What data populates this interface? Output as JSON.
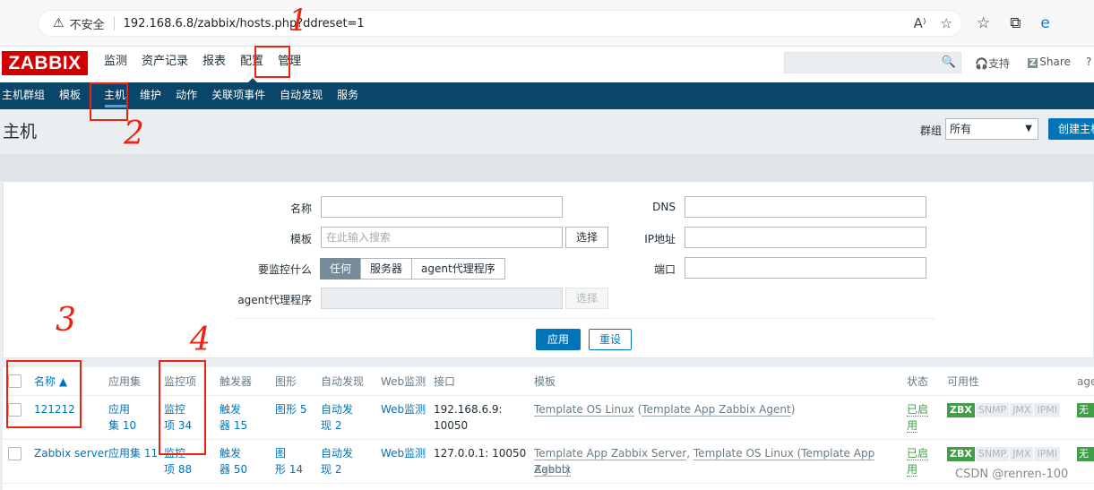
{
  "browser": {
    "security_label": "不安全",
    "url": "192.168.6.8/zabbix/hosts.php?ddreset=1"
  },
  "topnav": {
    "logo": "ZABBIX",
    "items": [
      "监测",
      "资产记录",
      "报表",
      "配置",
      "管理"
    ],
    "support": "支持",
    "share": "Share",
    "help": "?"
  },
  "subnav": {
    "items": [
      "主机群组",
      "模板",
      "主机",
      "维护",
      "动作",
      "关联项事件",
      "自动发现",
      "服务"
    ]
  },
  "header": {
    "title": "主机",
    "group_label": "群组",
    "group_value": "所有",
    "create_button": "创建主机"
  },
  "filter": {
    "name_label": "名称",
    "template_label": "模板",
    "template_placeholder": "在此输入搜索",
    "select_label": "选择",
    "monitored_by_label": "要监控什么",
    "monitored_options": [
      "任何",
      "服务器",
      "agent代理程序"
    ],
    "proxy_label": "agent代理程序",
    "proxy_select_label": "选择",
    "dns_label": "DNS",
    "ip_label": "IP地址",
    "port_label": "端口",
    "apply": "应用",
    "reset": "重设"
  },
  "table": {
    "headers": {
      "name": "名称 ▲",
      "applications": "应用集",
      "items": "监控项",
      "triggers": "触发器",
      "graphs": "图形",
      "discovery": "自动发现",
      "web": "Web监测",
      "interface": "接口",
      "templates": "模板",
      "status": "状态",
      "availability": "可用性",
      "agent_encryption": "age"
    },
    "rows": [
      {
        "name": "121212",
        "app_1": "应用",
        "app_2": "集 10",
        "items_1": "监控",
        "items_2": "项 34",
        "triggers_1": "触发",
        "triggers_2": "器 15",
        "graphs_1": "图形 5",
        "graphs_2": "",
        "discovery_1": "自动发",
        "discovery_2": "现 2",
        "web": "Web监测",
        "interface_1": "192.168.6.9:",
        "interface_2": "10050",
        "tpl_a": "Template OS Linux",
        "tpl_b": " (",
        "tpl_c": "Template App Zabbix Agent",
        "tpl_d": ")",
        "status_1": "已启",
        "status_2": "用",
        "enc": "无"
      },
      {
        "name": "Zabbix server",
        "app_1": "应用集 11",
        "app_2": "",
        "items_1": "监控",
        "items_2": "项 88",
        "triggers_1": "触发",
        "triggers_2": "器 50",
        "graphs_1": "图",
        "graphs_2": "形 14",
        "discovery_1": "自动发",
        "discovery_2": "现 2",
        "web": "Web监测",
        "interface_1": "127.0.0.1: 10050",
        "interface_2": "",
        "tpl_a": "Template App Zabbix Server",
        "tpl_b": ", ",
        "tpl_c": "Template OS Linux",
        "tpl_d": " (Template App Zabbix",
        "tpl_e": "Agent",
        "tpl_f": ")",
        "status_1": "已启",
        "status_2": "用",
        "enc": "无"
      }
    ],
    "availability_badges": [
      "ZBX",
      "SNMP",
      "JMX",
      "IPMI"
    ]
  },
  "annotations": [
    "1",
    "2",
    "3",
    "4"
  ],
  "watermark": "CSDN @renren-100"
}
